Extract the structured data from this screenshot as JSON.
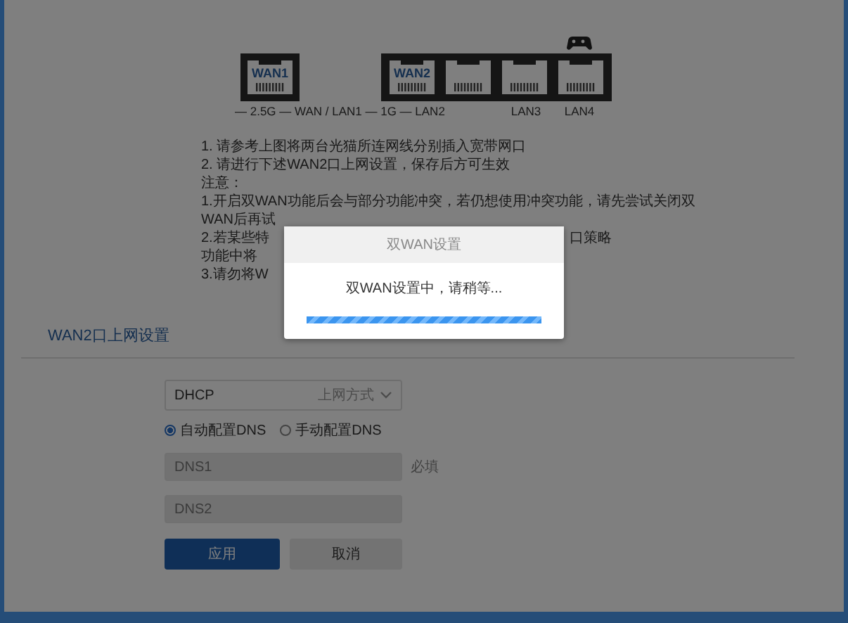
{
  "diagram": {
    "port_labels": [
      "WAN1",
      "WAN2"
    ],
    "link_labels": [
      "— 2.5G — WAN / LAN1 — 1G — LAN2",
      "LAN3",
      "LAN4"
    ]
  },
  "instructions": [
    {
      "text": "1. 请参考上图将两台光猫所连网线分别插入宽带网口"
    },
    {
      "text": "2. 请进行下述WAN2口上网设置，保存后方可生效"
    },
    {
      "text": "注意："
    },
    {
      "text": "1.开启双WAN功能后会与部分功能冲突，若仍想使用冲突功能，请先尝试关闭双"
    },
    {
      "text": "WAN后再试"
    },
    {
      "text": "2.若某些特",
      "after_gap": "口策略"
    },
    {
      "text": "功能中将"
    },
    {
      "text": "3.请勿将W"
    }
  ],
  "section": {
    "title": "WAN2口上网设置",
    "connection": {
      "value": "DHCP",
      "label": "上网方式"
    },
    "dns_modes": [
      {
        "label": "自动配置DNS",
        "selected": true
      },
      {
        "label": "手动配置DNS",
        "selected": false
      }
    ],
    "dns_fields": [
      {
        "placeholder": "DNS1",
        "hint": "必填",
        "disabled": true
      },
      {
        "placeholder": "DNS2",
        "disabled": true
      }
    ],
    "buttons": [
      {
        "label": "应用",
        "kind": "primary"
      },
      {
        "label": "取消",
        "kind": "secondary"
      }
    ]
  },
  "modal": {
    "title": "双WAN设置",
    "message": "双WAN设置中，请稍等...",
    "level": 1
  }
}
